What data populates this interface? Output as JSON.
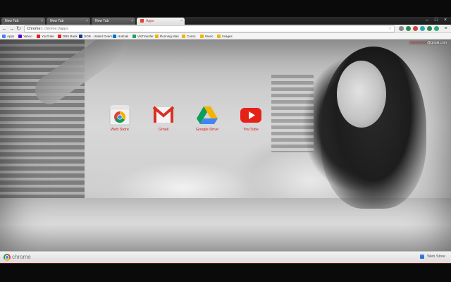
{
  "tabs": [
    {
      "label": "New Tab",
      "active": false
    },
    {
      "label": "New Tab",
      "active": false
    },
    {
      "label": "New Tab",
      "active": false
    },
    {
      "label": "Apps",
      "active": true
    }
  ],
  "toolbar": {
    "back": "←",
    "forward": "→",
    "reload": "↻",
    "url_host": "Chrome",
    "url_path": "chrome://apps",
    "star": "☆"
  },
  "bookmarks": [
    {
      "label": "Apps",
      "color": "#4285f4"
    },
    {
      "label": "Yahoo",
      "color": "#6001d2"
    },
    {
      "label": "YouTube",
      "color": "#e62117"
    },
    {
      "label": "DBS Bank",
      "color": "#e2231a"
    },
    {
      "label": "UOB - United Overs...",
      "color": "#0b3f91"
    },
    {
      "label": "Hotmail",
      "color": "#0072c6"
    },
    {
      "label": "VisTransfer",
      "color": "#1aa260"
    },
    {
      "label": "Running Man",
      "color": "#f4b400"
    },
    {
      "label": "Comic",
      "color": "#f4b400"
    },
    {
      "label": "Music",
      "color": "#f4b400"
    },
    {
      "label": "Images",
      "color": "#f4b400"
    }
  ],
  "account": {
    "user": "xxxxxxxxxx",
    "domain": "@gmail.com"
  },
  "apps": [
    {
      "name": "Web Store",
      "icon": "webstore-icon"
    },
    {
      "name": "Gmail",
      "icon": "gmail-icon"
    },
    {
      "name": "Google Drive",
      "icon": "drive-icon"
    },
    {
      "name": "YouTube",
      "icon": "youtube-icon"
    }
  ],
  "bottom": {
    "brand": "chrome",
    "webstore": "Web Store"
  },
  "colors": {
    "app_label": "#d21f1f",
    "frame_border": "#6b1b1b"
  }
}
